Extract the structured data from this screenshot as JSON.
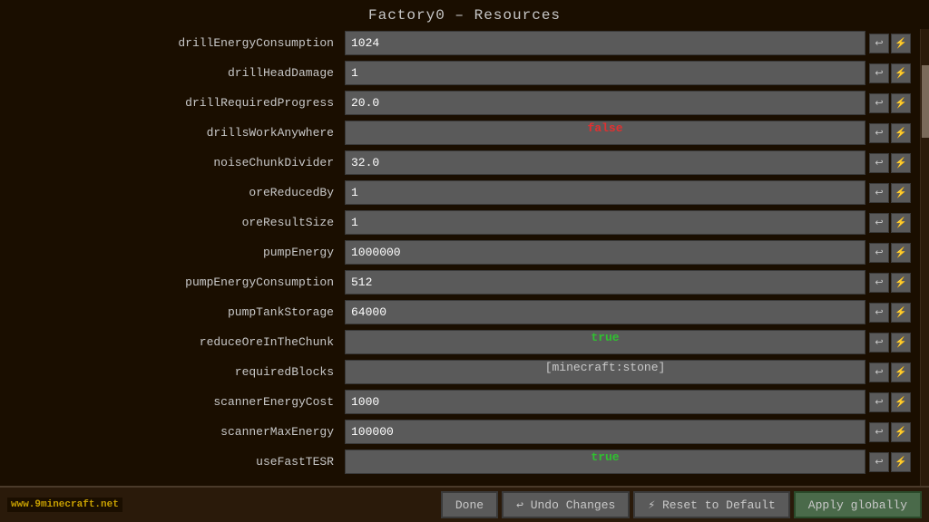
{
  "title": "Factory0 – Resources",
  "rows": [
    {
      "label": "drillEnergyConsumption",
      "value": "1024",
      "type": "number"
    },
    {
      "label": "drillHeadDamage",
      "value": "1",
      "type": "number"
    },
    {
      "label": "drillRequiredProgress",
      "value": "20.0",
      "type": "number"
    },
    {
      "label": "drillsWorkAnywhere",
      "value": "false",
      "type": "bool-false"
    },
    {
      "label": "noiseChunkDivider",
      "value": "32.0",
      "type": "number"
    },
    {
      "label": "oreReducedBy",
      "value": "1",
      "type": "number"
    },
    {
      "label": "oreResultSize",
      "value": "1",
      "type": "number"
    },
    {
      "label": "pumpEnergy",
      "value": "1000000",
      "type": "number"
    },
    {
      "label": "pumpEnergyConsumption",
      "value": "512",
      "type": "number"
    },
    {
      "label": "pumpTankStorage",
      "value": "64000",
      "type": "number"
    },
    {
      "label": "reduceOreInTheChunk",
      "value": "true",
      "type": "bool-true"
    },
    {
      "label": "requiredBlocks",
      "value": "[minecraft:stone]",
      "type": "list"
    },
    {
      "label": "scannerEnergyCost",
      "value": "1000",
      "type": "number"
    },
    {
      "label": "scannerMaxEnergy",
      "value": "100000",
      "type": "number"
    },
    {
      "label": "useFastTESR",
      "value": "true",
      "type": "bool-true"
    }
  ],
  "footer": {
    "watermark": "www.9minecraft.net",
    "done_label": "Done",
    "undo_label": "↩ Undo Changes",
    "reset_label": "⚡ Reset to Default",
    "apply_label": "Apply globally"
  }
}
